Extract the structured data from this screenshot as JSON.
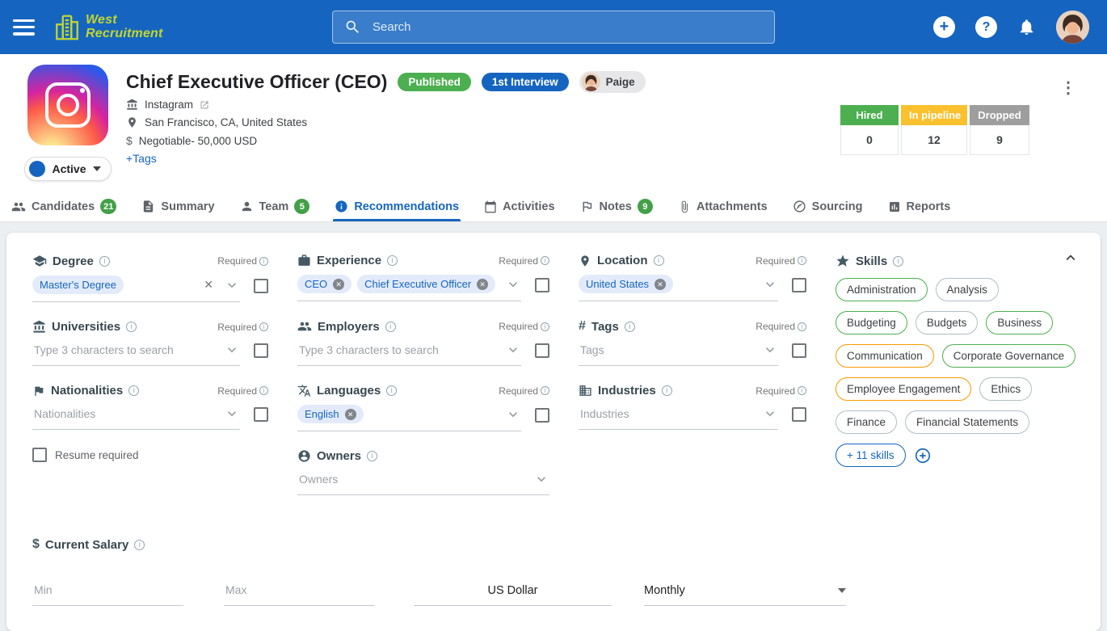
{
  "topbar": {
    "logo_line1": "West",
    "logo_line2": "Recruitment",
    "search_placeholder": "Search"
  },
  "header": {
    "title": "Chief Executive Officer (CEO)",
    "status_badge": "Published",
    "stage_badge": "1st Interview",
    "owner_badge": "Paige",
    "company": "Instagram",
    "location": "San Francisco, CA, United States",
    "salary": "Negotiable- 50,000 USD",
    "tags_link": "+Tags",
    "active_label": "Active",
    "stats": [
      {
        "label": "Hired",
        "value": "0",
        "color": "#4caf50"
      },
      {
        "label": "In pipeline",
        "value": "12",
        "color": "#fbc02d"
      },
      {
        "label": "Dropped",
        "value": "9",
        "color": "#9e9e9e"
      }
    ]
  },
  "tabs": [
    {
      "label": "Candidates",
      "badge": "21"
    },
    {
      "label": "Summary"
    },
    {
      "label": "Team",
      "badge": "5"
    },
    {
      "label": "Recommendations"
    },
    {
      "label": "Activities"
    },
    {
      "label": "Notes",
      "badge": "9"
    },
    {
      "label": "Attachments"
    },
    {
      "label": "Sourcing"
    },
    {
      "label": "Reports"
    }
  ],
  "form": {
    "required_label": "Required",
    "degree": {
      "label": "Degree",
      "chip": "Master's Degree"
    },
    "universities": {
      "label": "Universities",
      "placeholder": "Type 3 characters to search"
    },
    "nationalities": {
      "label": "Nationalities",
      "placeholder": "Nationalities"
    },
    "resume_required_label": "Resume required",
    "experience": {
      "label": "Experience",
      "chips": [
        "CEO",
        "Chief Executive Officer"
      ]
    },
    "employers": {
      "label": "Employers",
      "placeholder": "Type 3 characters to search"
    },
    "languages": {
      "label": "Languages",
      "chip": "English"
    },
    "owners": {
      "label": "Owners",
      "placeholder": "Owners"
    },
    "location": {
      "label": "Location",
      "chip": "United States"
    },
    "tags": {
      "label": "Tags",
      "placeholder": "Tags"
    },
    "industries": {
      "label": "Industries",
      "placeholder": "Industries"
    },
    "skills": {
      "label": "Skills",
      "chips": [
        {
          "label": "Administration",
          "color": "#4caf50"
        },
        {
          "label": "Analysis",
          "color": "#b0bec5"
        },
        {
          "label": "Budgeting",
          "color": "#4caf50"
        },
        {
          "label": "Budgets",
          "color": "#b0bec5"
        },
        {
          "label": "Business",
          "color": "#4caf50"
        },
        {
          "label": "Communication",
          "color": "#ff9800"
        },
        {
          "label": "Corporate Governance",
          "color": "#4caf50"
        },
        {
          "label": "Employee Engagement",
          "color": "#ff9800"
        },
        {
          "label": "Ethics",
          "color": "#b0bec5"
        },
        {
          "label": "Finance",
          "color": "#b0bec5"
        },
        {
          "label": "Financial Statements",
          "color": "#b0bec5"
        }
      ],
      "more_label": "+ 11 skills"
    },
    "current_salary": {
      "label": "Current Salary",
      "min_placeholder": "Min",
      "max_placeholder": "Max",
      "currency": "US Dollar",
      "period": "Monthly"
    }
  },
  "colors": {
    "topbar": "#1565c0",
    "accent": "#1565c0",
    "published_green": "#4caf50",
    "badge_green": "#43a047"
  }
}
